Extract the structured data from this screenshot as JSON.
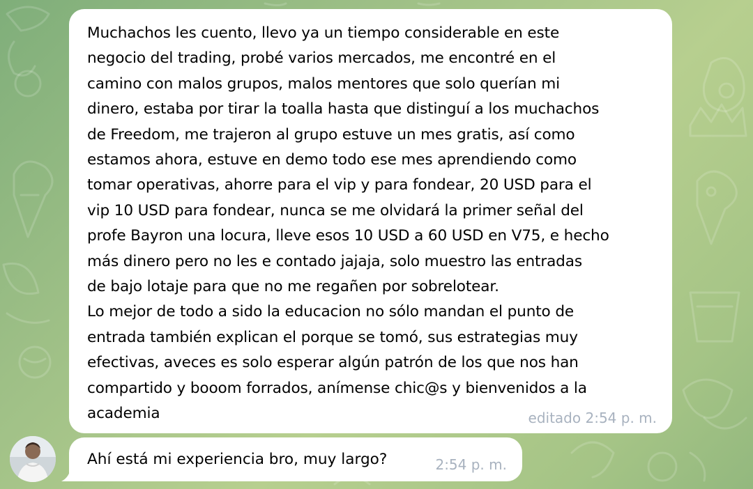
{
  "messages": [
    {
      "text": "Muchachos les cuento, llevo ya un tiempo considerable en este\nnegocio del trading, probé varios mercados, me encontré en el\ncamino con malos grupos, malos mentores que solo querían mi\ndinero, estaba por tirar la toalla hasta que distinguí a los muchachos\nde Freedom, me trajeron al grupo estuve un mes gratis, así como\nestamos ahora, estuve en demo todo ese mes aprendiendo como\ntomar operativas, ahorre para el vip y para fondear, 20 USD para el\nvip 10 USD para fondear, nunca se me olvidará la primer señal del\nprofe Bayron una locura, lleve esos 10 USD a 60 USD en V75, e hecho\nmás dinero pero no les e contado jajaja, solo muestro las entradas\nde bajo lotaje para que no me regañen por sobrelotear.\nLo mejor de todo a sido la educacion no sólo mandan el punto de\nentrada también explican el porque se tomó, sus estrategias muy\nefectivas, aveces es solo esperar algún patrón de los que nos han\ncompartido y booom forrados, anímense chic@s y bienvenidos a la\nacademia",
      "meta": "editado 2:54 p. m."
    },
    {
      "text": "Ahí está mi experiencia bro, muy largo?",
      "meta": "2:54 p. m."
    }
  ],
  "icons": {
    "avatar": "user-avatar-photo",
    "wallpaper": "doodle-pattern"
  },
  "colors": {
    "bubble": "#ffffff",
    "meta_text": "#a8b2bf",
    "wallpaper_start": "#7fae7a",
    "wallpaper_end": "#b7cf8f"
  }
}
